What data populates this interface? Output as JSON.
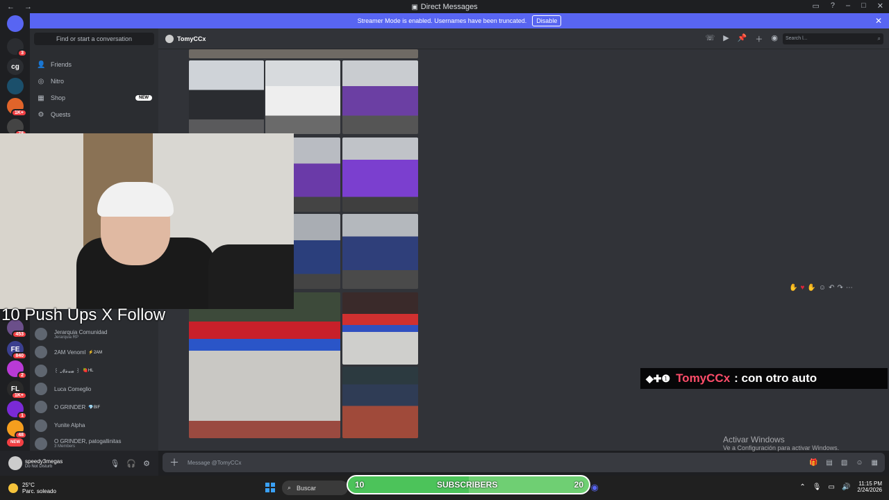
{
  "window": {
    "title": "Direct Messages",
    "nav_back": "←",
    "nav_forward": "→"
  },
  "banner": {
    "message": "Streamer Mode is enabled. Usernames have been truncated.",
    "button": "Disable"
  },
  "servers": [
    {
      "label": "",
      "badge": "",
      "color": "#5865f2"
    },
    {
      "label": "",
      "badge": "3",
      "color": "#2b2d31"
    },
    {
      "label": "cg",
      "badge": "",
      "color": "#2b2d31"
    },
    {
      "label": "",
      "badge": "",
      "color": "#1b4f6b"
    },
    {
      "label": "",
      "badge": "1K+",
      "color": "#e0642a"
    },
    {
      "label": "",
      "badge": "78",
      "color": "#444"
    }
  ],
  "servers_lower": [
    {
      "label": "",
      "badge": "453",
      "color": "#6b4f8a"
    },
    {
      "label": "FE",
      "badge": "840",
      "color": "#3b3f8f"
    },
    {
      "label": "",
      "badge": "2",
      "color": "#b83ad6"
    },
    {
      "label": "FL",
      "badge": "1K+",
      "color": "#2a2a2a"
    },
    {
      "label": "",
      "badge": "1",
      "color": "#7a2ad6"
    },
    {
      "label": "",
      "badge": "48",
      "color": "#f59e1e"
    },
    {
      "label": "NEW",
      "badge": "",
      "color": "#f23f43"
    }
  ],
  "dm": {
    "search_placeholder": "Find or start a conversation",
    "nav": [
      {
        "icon": "friends-icon",
        "label": "Friends"
      },
      {
        "icon": "nitro-icon",
        "label": "Nitro"
      },
      {
        "icon": "shop-icon",
        "label": "Shop",
        "badge": "NEW"
      },
      {
        "icon": "quests-icon",
        "label": "Quests"
      }
    ],
    "section_title": "Direct Messages",
    "conversations": [
      {
        "name": "Jerarquia Comunidad",
        "sub": "Jerarquia RP",
        "tag": ""
      },
      {
        "name": "2AM Venoml",
        "sub": "",
        "tag": "⚡2AM"
      },
      {
        "name": "꒰ 𝓝𝓸𝓿𝓪 ꒱",
        "sub": "",
        "tag": "🍓HL"
      },
      {
        "name": "Luca Comeglio",
        "sub": "",
        "tag": ""
      },
      {
        "name": "O GRINDER",
        "sub": "",
        "tag": "💎BIF"
      },
      {
        "name": "Yunite Alpha",
        "sub": "",
        "tag": ""
      },
      {
        "name": "O GRINDER, patogallinitas",
        "sub": "3 Members",
        "tag": ""
      }
    ]
  },
  "user": {
    "name": "speedy3megas",
    "status": "Do Not Disturb"
  },
  "chat": {
    "recipient": "TomyCCx",
    "search_placeholder": "Search l...",
    "input_placeholder": "Message @TomyCCx"
  },
  "stream": {
    "overlay_text": "10 Push Ups X Follow",
    "chat_message_user": "TomyCCx",
    "chat_message_text": ": con otro auto",
    "subs_current": "10",
    "subs_label": "SUBSCRIBERS",
    "subs_goal": "20",
    "subs_progress": 0.5
  },
  "windows": {
    "activate_title": "Activar Windows",
    "activate_sub": "Ve a Configuración para activar Windows."
  },
  "taskbar": {
    "temp": "25°C",
    "weather": "Parc. soleado",
    "search": "Buscar",
    "time": "11:15 PM",
    "date": "2/24/2026"
  },
  "colors": {
    "brand": "#5865f2",
    "chat_bg": "#313338",
    "sidebar_bg": "#2b2d31"
  }
}
